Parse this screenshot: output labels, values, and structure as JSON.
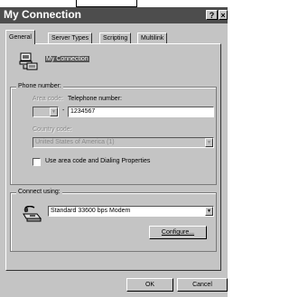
{
  "window": {
    "title": "My Connection",
    "help_button": "?",
    "close_button": "×"
  },
  "tabs": [
    {
      "label": "General",
      "active": true
    },
    {
      "label": "Server Types",
      "active": false
    },
    {
      "label": "Scripting",
      "active": false
    },
    {
      "label": "Multilink",
      "active": false
    }
  ],
  "general": {
    "connection_name": "My Connection",
    "phone_group": {
      "legend": "Phone number:",
      "area_code_label": "Area code:",
      "area_code_value": "",
      "separator": "-",
      "telephone_label": "Telephone number:",
      "telephone_value": "1234567",
      "country_label": "Country code:",
      "country_value": "United States of America (1)",
      "use_area_checkbox_label": "Use area code and Dialing Properties",
      "use_area_checked": false
    },
    "connect_group": {
      "legend": "Connect using:",
      "modem_value": "Standard 33600 bps Modem",
      "configure_label": "Configure..."
    }
  },
  "footer": {
    "ok_label": "OK",
    "cancel_label": "Cancel"
  }
}
